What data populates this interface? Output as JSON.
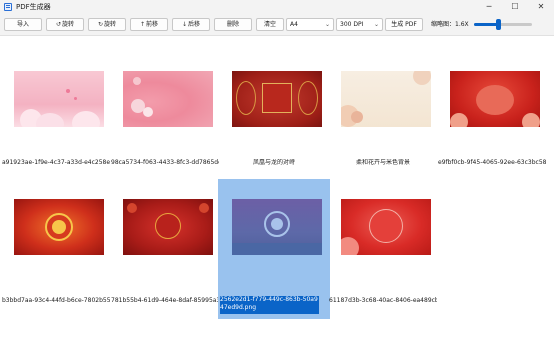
{
  "window": {
    "title": "PDF生成器",
    "controls": {
      "minimize": "─",
      "maximize": "☐",
      "close": "✕"
    }
  },
  "toolbar": {
    "import_label": "导入",
    "rotate_left_label": "旋转",
    "rotate_right_label": "旋转",
    "move_up_label": "前移",
    "move_down_label": "后移",
    "delete_label": "删除",
    "clear_label": "清空",
    "page_size": {
      "selected": "A4"
    },
    "dpi": {
      "selected": "300 DPI"
    },
    "generate_label": "生成 PDF",
    "zoom_label": "缩略图：1.6X",
    "zoom_slider_fraction": 0.4,
    "accent_color": "#0a64c8"
  },
  "images": [
    {
      "caption": "a91923ae-1f9e-4c37-a33d-e4c258e6...",
      "selected": false
    },
    {
      "caption": "98ca5734-f063-4433-8fc3-dd7865de2...",
      "selected": false
    },
    {
      "caption": "凤凰与龙的对峙",
      "selected": false
    },
    {
      "caption": "柔和花卉与米色背景",
      "selected": false
    },
    {
      "caption": "e9fbf0cb-9f45-4065-92ee-63c3bc58f...",
      "selected": false
    },
    {
      "caption": "b3bbd7aa-93c4-44fd-b6ce-7802b55...",
      "selected": false
    },
    {
      "caption": "781b55b4-61d9-464e-8daf-85995a37...",
      "selected": false
    },
    {
      "caption": "2562e2d1-f779-449c-863b-50a947ed9d.png",
      "selected": true
    },
    {
      "caption": "61187d3b-3c68-40ac-8406-ea489cb1...",
      "selected": false
    }
  ]
}
